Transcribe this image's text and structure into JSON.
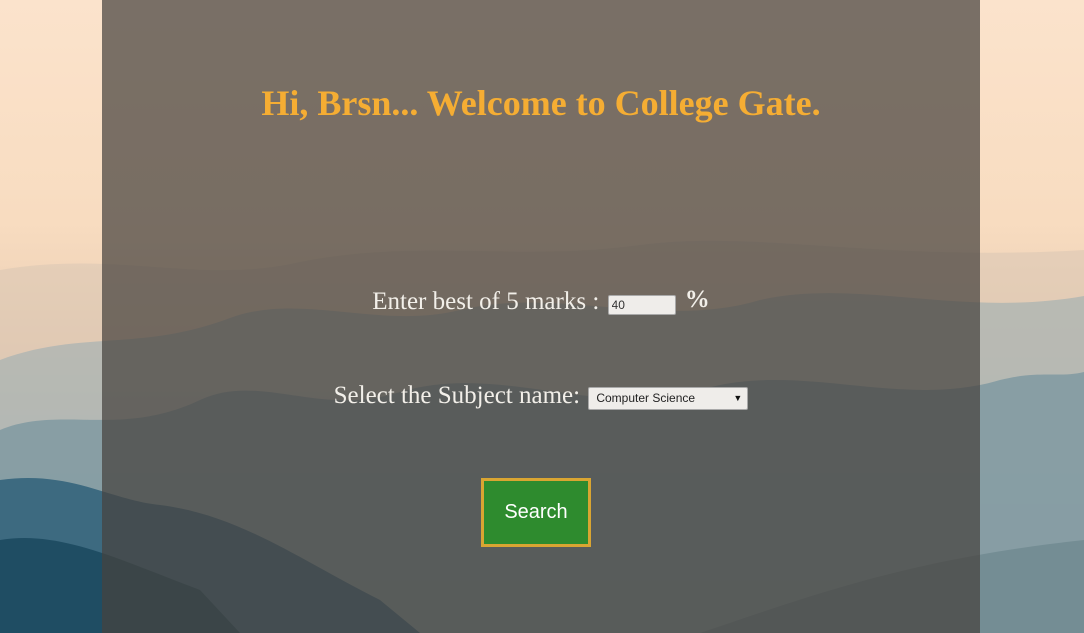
{
  "header": {
    "title": "Hi, Brsn... Welcome to College Gate."
  },
  "form": {
    "marks_label": "Enter best of 5 marks :",
    "marks_value": "40",
    "percent_sign": "%",
    "subject_label": "Select the Subject name:",
    "subject_selected": "Computer Science",
    "dropdown_arrow": "▼",
    "search_label": "Search"
  },
  "colors": {
    "title": "#f5ad33",
    "button_bg": "#2e8b2e",
    "button_border": "#d9a532"
  }
}
